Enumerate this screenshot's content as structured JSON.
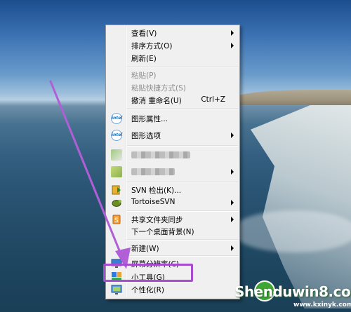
{
  "menu": {
    "view": "查看(V)",
    "sort": "排序方式(O)",
    "refresh": "刷新(E)",
    "paste": "粘贴(P)",
    "paste_shortcut": "粘贴快捷方式(S)",
    "undo": "撤消 重命名(U)",
    "undo_shortcut": "Ctrl+Z",
    "graphics_properties": "图形属性...",
    "graphics_options": "图形选项",
    "svn_checkout": "SVN 检出(K)...",
    "tortoise_svn": "TortoiseSVN",
    "shared_folder_sync": "共享文件夹同步",
    "next_background": "下一个桌面背景(N)",
    "new": "新建(W)",
    "screen_resolution": "屏幕分辨率(C)",
    "gadgets": "小工具(G)",
    "personalize": "个性化(R)"
  },
  "watermark": {
    "brand": "Shenduwin8.com",
    "url": "www.kxinyk.com"
  },
  "colors": {
    "highlight_box": "#a64ccf",
    "arrow": "#b05fd6",
    "menu_bg": "#f0f0f0"
  }
}
